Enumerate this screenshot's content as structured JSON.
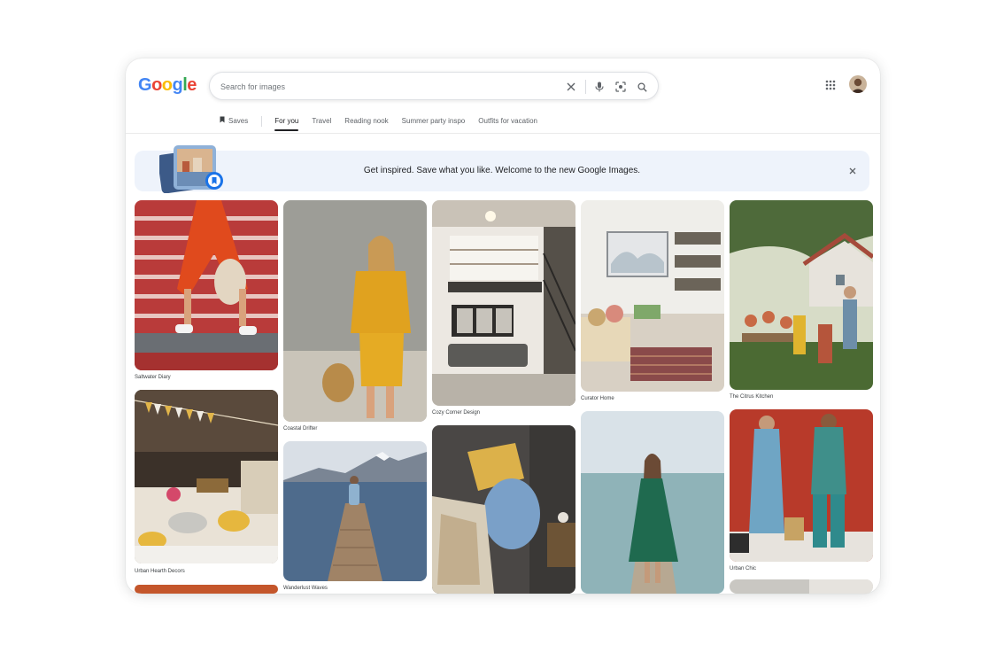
{
  "logo": [
    "G",
    "o",
    "o",
    "g",
    "l",
    "e"
  ],
  "search": {
    "placeholder": "Search for images"
  },
  "tabs": [
    {
      "label": "Saves",
      "icon": "bookmark-icon"
    },
    {
      "label": "For you",
      "active": true
    },
    {
      "label": "Travel"
    },
    {
      "label": "Reading nook"
    },
    {
      "label": "Summer party inspo"
    },
    {
      "label": "Outfits for vacation"
    }
  ],
  "banner": {
    "text": "Get inspired. Save what you like. Welcome to the new Google Images."
  },
  "images": [
    {
      "caption": "Saltwater Diary"
    },
    {
      "caption": "Urban Hearth Decors"
    },
    {
      "caption": "Coastal Drifter"
    },
    {
      "caption": "Wanderlust Waves"
    },
    {
      "caption": "Cozy Corner Design"
    },
    {
      "caption": "Curator Home"
    },
    {
      "caption": "The Citrus Kitchen"
    },
    {
      "caption": "Urban Chic"
    }
  ],
  "colors": {
    "google_blue": "#4285F4",
    "google_red": "#EA4335",
    "google_yellow": "#FBBC05",
    "google_green": "#34A853",
    "banner_bg": "#eef3fb"
  }
}
